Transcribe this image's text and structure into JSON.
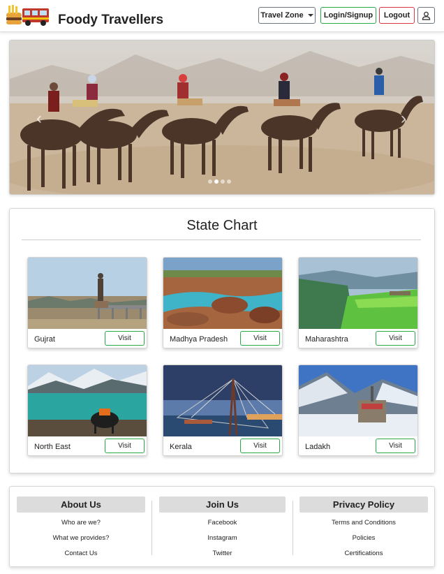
{
  "header": {
    "brand": "Foody Travellers",
    "travel_zone_label": "Travel Zone",
    "login_label": "Login/Signup",
    "logout_label": "Logout"
  },
  "states": {
    "title": "State Chart",
    "visit_label": "Visit",
    "cards": [
      {
        "name": "Gujrat"
      },
      {
        "name": "Madhya Pradesh"
      },
      {
        "name": "Maharashtra"
      },
      {
        "name": "North East"
      },
      {
        "name": "Kerala"
      },
      {
        "name": "Ladakh"
      }
    ]
  },
  "footer": {
    "columns": [
      {
        "heading": "About Us",
        "links": [
          "Who are we?",
          "What we provides?",
          "Contact Us"
        ]
      },
      {
        "heading": "Join Us",
        "links": [
          "Facebook",
          "Instagram",
          "Twitter"
        ]
      },
      {
        "heading": "Privacy Policy",
        "links": [
          "Terms and Conditions",
          "Policies",
          "Certifications"
        ]
      }
    ]
  },
  "carousel": {
    "slide_count": 4,
    "active_slide": 2
  }
}
